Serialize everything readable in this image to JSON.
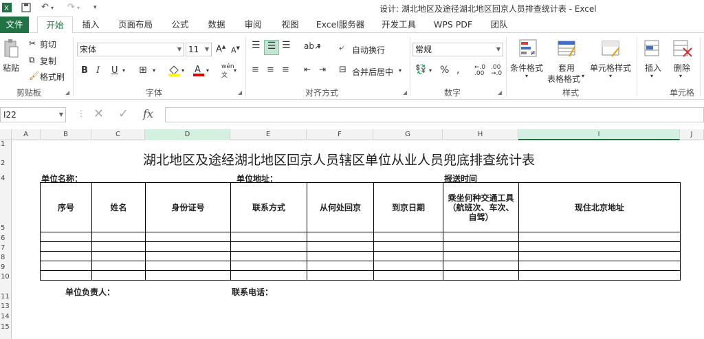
{
  "window": {
    "title": "设计: 湖北地区及途径湖北地区回京人员排查统计表 - Excel"
  },
  "tabs": [
    "文件",
    "开始",
    "插入",
    "页面布局",
    "公式",
    "数据",
    "审阅",
    "视图",
    "Excel服务器",
    "开发工具",
    "WPS PDF",
    "团队"
  ],
  "ribbon": {
    "clipboard": {
      "paste": "粘贴",
      "cut": "剪切",
      "copy": "复制",
      "format_painter": "格式刷",
      "label": "剪贴板"
    },
    "font": {
      "name": "宋体",
      "size": "11",
      "label": "字体",
      "bold": "B",
      "italic": "I",
      "underline": "U"
    },
    "alignment": {
      "wrap": "自动换行",
      "merge": "合并后居中",
      "label": "对齐方式"
    },
    "number": {
      "format": "常规",
      "percent": "%",
      "label": "数字"
    },
    "styles": {
      "conditional": "条件格式",
      "table_fmt_1": "套用",
      "table_fmt_2": "表格格式",
      "cell_styles": "单元格样式",
      "label": "样式"
    },
    "cells": {
      "insert": "插入",
      "delete": "删除",
      "label": "单元格"
    }
  },
  "formula_bar": {
    "name_box": "I22",
    "fx": "fx",
    "value": ""
  },
  "columns": [
    "A",
    "B",
    "C",
    "D",
    "E",
    "F",
    "G",
    "H",
    "I",
    "J"
  ],
  "rows": [
    "1",
    "2",
    "4",
    "5",
    "6",
    "7",
    "8",
    "9",
    "10",
    "11",
    "13",
    "14",
    "15"
  ],
  "sheet": {
    "title": "湖北地区及途经湖北地区回京人员辖区单位从业人员兜底排查统计表",
    "unit_name": "单位名称：",
    "unit_address": "单位地址：",
    "report_time": "报送时间",
    "headers": [
      "序号",
      "姓名",
      "身份证号",
      "联系方式",
      "从何处回京",
      "到京日期",
      "乘坐何种交通工具（航班次、车次、自驾）",
      "现住北京地址"
    ],
    "responsible": "单位负责人：",
    "phone": "联系电话："
  }
}
